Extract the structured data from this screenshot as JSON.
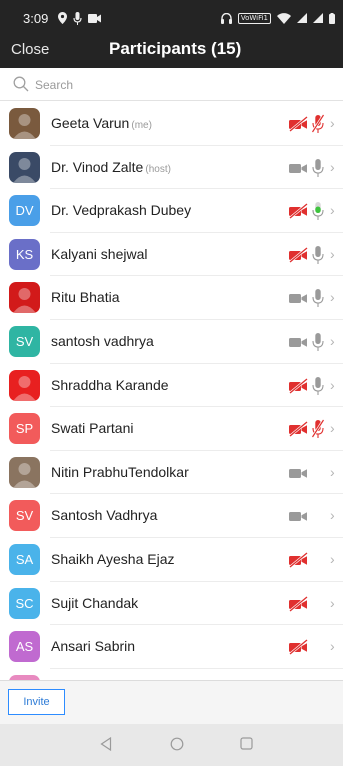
{
  "status_bar": {
    "time": "3:09",
    "wifi_badge": "VoWiFi1"
  },
  "header": {
    "close_label": "Close",
    "title": "Participants (15)"
  },
  "search": {
    "placeholder": "Search"
  },
  "participants": [
    {
      "name": "Geeta Varun",
      "role": "(me)",
      "avatar_type": "photo",
      "avatar_color": "#7a5a3e",
      "video": "off",
      "audio": "muted"
    },
    {
      "name": "Dr. Vinod Zalte",
      "role": "(host)",
      "avatar_type": "photo",
      "avatar_color": "#3a4a66",
      "video": "on",
      "audio": "on"
    },
    {
      "name": "Dr. Vedprakash Dubey",
      "role": "",
      "avatar_type": "initials",
      "initials": "DV",
      "avatar_color": "#4a9fe8",
      "video": "off",
      "audio": "speaking"
    },
    {
      "name": "Kalyani shejwal",
      "role": "",
      "avatar_type": "initials",
      "initials": "KS",
      "avatar_color": "#6a6fc8",
      "video": "off",
      "audio": "on"
    },
    {
      "name": "Ritu Bhatia",
      "role": "",
      "avatar_type": "photo",
      "avatar_color": "#d21a1a",
      "video": "on",
      "audio": "on"
    },
    {
      "name": "santosh vadhrya",
      "role": "",
      "avatar_type": "initials",
      "initials": "SV",
      "avatar_color": "#2fb5a3",
      "video": "on",
      "audio": "on"
    },
    {
      "name": "Shraddha Karande",
      "role": "",
      "avatar_type": "photo",
      "avatar_color": "#e82020",
      "video": "off",
      "audio": "on"
    },
    {
      "name": "Swati Partani",
      "role": "",
      "avatar_type": "initials",
      "initials": "SP",
      "avatar_color": "#f25b5b",
      "video": "off",
      "audio": "muted"
    },
    {
      "name": "Nitin PrabhuTendolkar",
      "role": "",
      "avatar_type": "photo",
      "avatar_color": "#8a7460",
      "video": "on",
      "audio": "none"
    },
    {
      "name": "Santosh Vadhrya",
      "role": "",
      "avatar_type": "initials",
      "initials": "SV",
      "avatar_color": "#f25b5b",
      "video": "on",
      "audio": "none"
    },
    {
      "name": "Shaikh Ayesha Ejaz",
      "role": "",
      "avatar_type": "initials",
      "initials": "SA",
      "avatar_color": "#4ab3ea",
      "video": "off",
      "audio": "none"
    },
    {
      "name": "Sujit Chandak",
      "role": "",
      "avatar_type": "initials",
      "initials": "SC",
      "avatar_color": "#4ab3ea",
      "video": "off",
      "audio": "none"
    },
    {
      "name": "Ansari Sabrin",
      "role": "",
      "avatar_type": "initials",
      "initials": "AS",
      "avatar_color": "#c06ad0",
      "video": "off",
      "audio": "none"
    },
    {
      "name": "",
      "role": "",
      "avatar_type": "initials",
      "initials": "",
      "avatar_color": "#e88ac0",
      "video": "none",
      "audio": "none"
    }
  ],
  "footer": {
    "invite_label": "Invite"
  },
  "colors": {
    "topbar": "#242424",
    "muted_red": "#e0302f",
    "speaking_green": "#3ec43e",
    "icon_gray": "#9a9a9a",
    "accent_blue": "#2d8cff"
  }
}
